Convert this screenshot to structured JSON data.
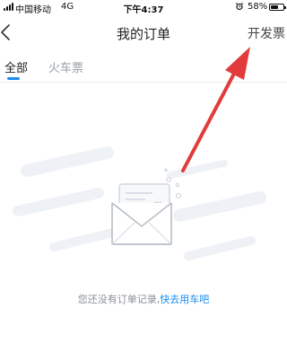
{
  "status_bar": {
    "carrier": "中国移动",
    "network": "4G",
    "time": "下午4:37",
    "battery": "58%",
    "battery_level": 0.58,
    "signal_bars": 4
  },
  "nav": {
    "title": "我的订单",
    "action": "开发票"
  },
  "tabs": [
    {
      "label": "全部",
      "active": true
    },
    {
      "label": "火车票",
      "active": false
    }
  ],
  "empty_state": {
    "message": "您还没有订单记录,",
    "link": "快去用车吧"
  },
  "colors": {
    "accent": "#1a8cf0",
    "annotation_arrow": "#e23b3b"
  },
  "icons": [
    "back-chevron-icon",
    "alarm-clock-icon",
    "battery-icon",
    "empty-envelope-icon"
  ]
}
